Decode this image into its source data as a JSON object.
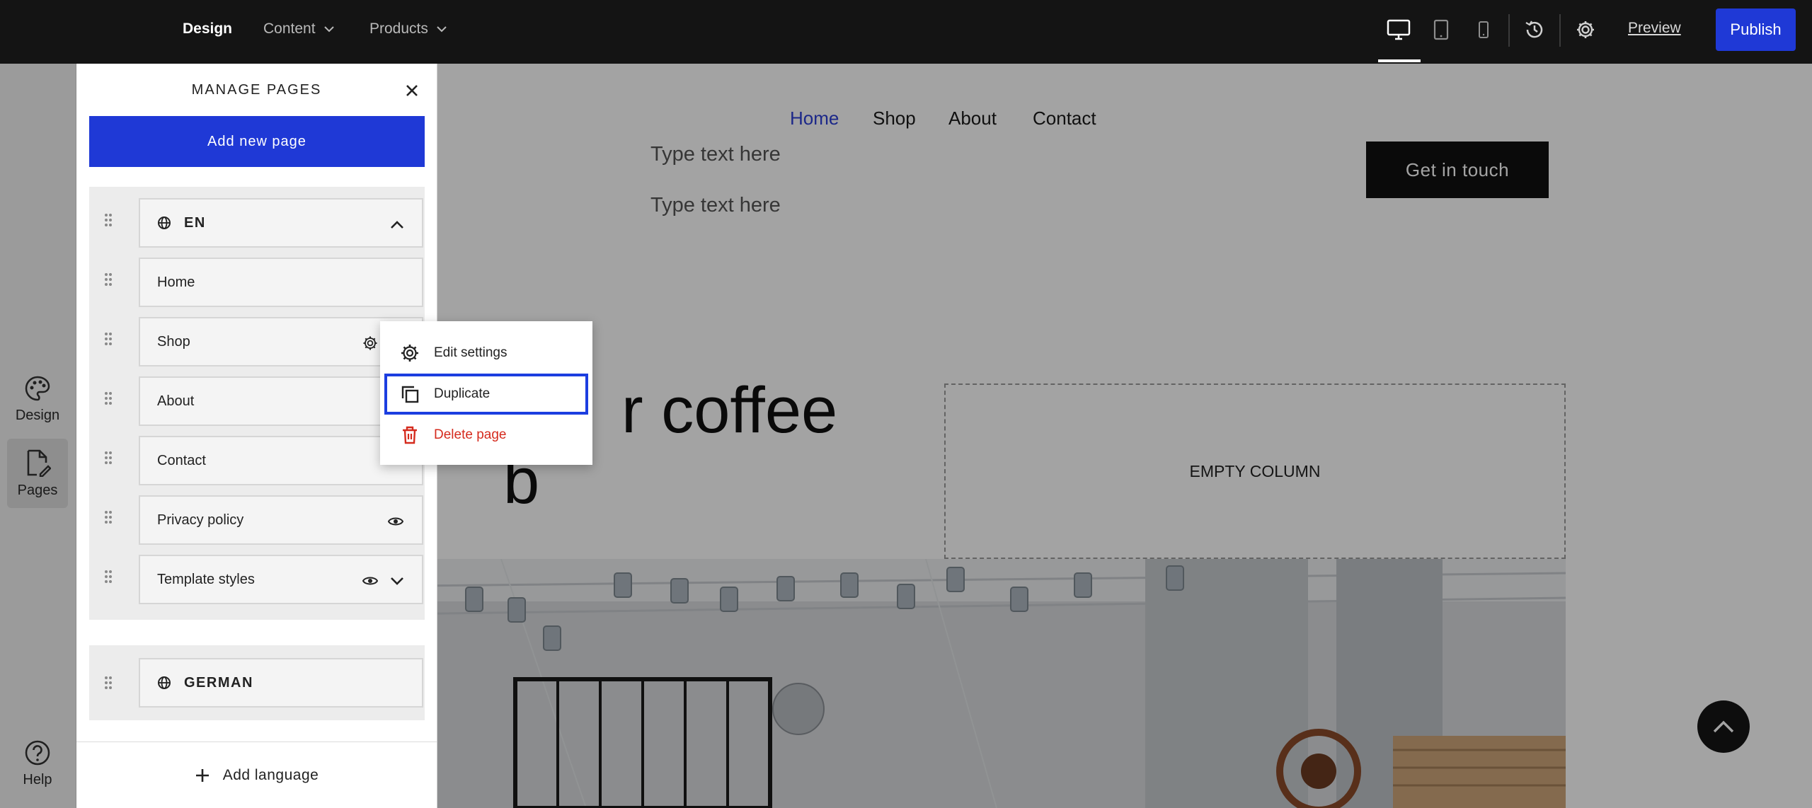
{
  "topbar": {
    "nav": [
      {
        "label": "Design"
      },
      {
        "label": "Content"
      },
      {
        "label": "Products"
      }
    ],
    "icons": [
      "desktop-icon",
      "tablet-icon",
      "mobile-icon",
      "history-icon",
      "gear-icon"
    ],
    "preview_label": "Preview",
    "publish_label": "Publish"
  },
  "rail": {
    "items": [
      {
        "label": "Design",
        "icon": "palette-icon"
      },
      {
        "label": "Pages",
        "icon": "pages-icon"
      },
      {
        "label": "Help",
        "icon": "help-icon"
      }
    ]
  },
  "site": {
    "nav": [
      "Home",
      "Shop",
      "About",
      "Contact"
    ],
    "placeholder_1": "Type text here",
    "placeholder_2": "Type text here",
    "cta": "Get in touch",
    "headline_line1": "r coffee",
    "headline_line2": "b",
    "empty_column": "EMPTY COLUMN"
  },
  "panel": {
    "title": "MANAGE PAGES",
    "add_page": "Add new page",
    "languages": [
      {
        "label": "EN",
        "pages": [
          "Home",
          "Shop",
          "About",
          "Contact",
          "Privacy policy",
          "Template styles"
        ]
      },
      {
        "label": "GERMAN"
      }
    ],
    "add_language": "Add language"
  },
  "context_menu": {
    "items": [
      {
        "label": "Edit settings",
        "icon": "gear-icon"
      },
      {
        "label": "Duplicate",
        "icon": "duplicate-icon"
      },
      {
        "label": "Delete page",
        "icon": "trash-icon"
      }
    ]
  },
  "colors": {
    "accent": "#1f39d6",
    "topbar": "#141414",
    "danger": "#d52b1e",
    "focus": "#1c3ee0"
  }
}
